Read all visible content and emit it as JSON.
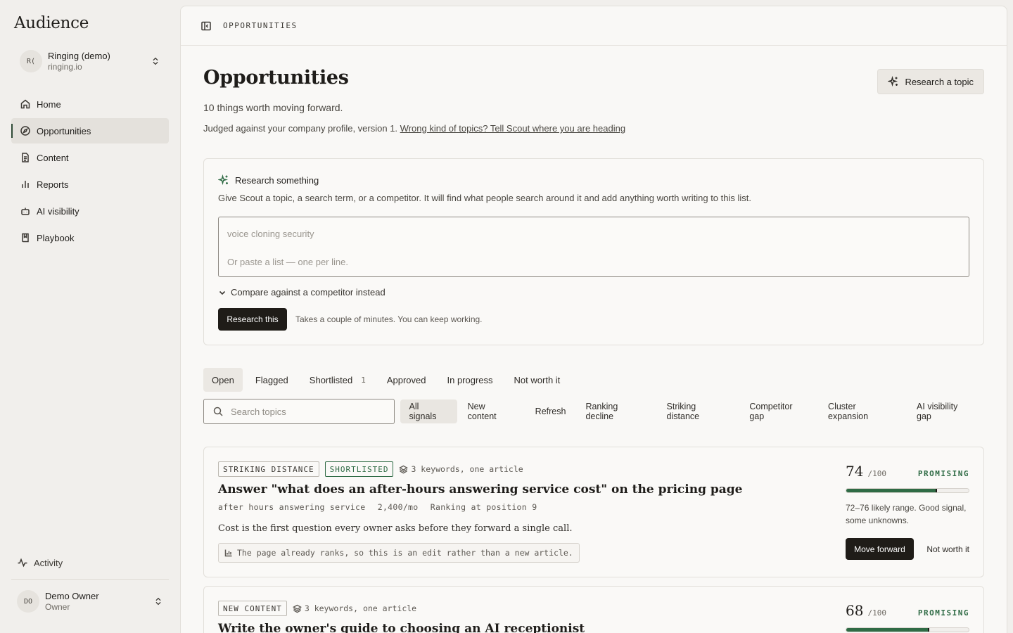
{
  "app": {
    "brand": "Audience"
  },
  "workspace": {
    "initials": "R(",
    "name": "Ringing (demo)",
    "domain": "ringing.io"
  },
  "nav": [
    {
      "label": "Home",
      "icon": "home-icon"
    },
    {
      "label": "Opportunities",
      "icon": "compass-icon",
      "active": true
    },
    {
      "label": "Content",
      "icon": "document-icon"
    },
    {
      "label": "Reports",
      "icon": "bar-chart-icon"
    },
    {
      "label": "AI visibility",
      "icon": "bot-icon"
    },
    {
      "label": "Playbook",
      "icon": "book-icon"
    }
  ],
  "activity": {
    "label": "Activity"
  },
  "user": {
    "initials": "DO",
    "name": "Demo Owner",
    "role": "Owner"
  },
  "topbar": {
    "breadcrumb": "OPPORTUNITIES"
  },
  "page": {
    "title": "Opportunities",
    "research_topic_button": "Research a topic",
    "subtitle": "10 things worth moving forward.",
    "judged_text": "Judged against your company profile, version 1.",
    "judged_link": "Wrong kind of topics? Tell Scout where you are heading"
  },
  "research": {
    "heading": "Research something",
    "description": "Give Scout a topic, a search term, or a competitor. It will find what people search around it and add anything worth writing to this list.",
    "placeholder_line1": "voice cloning security",
    "placeholder_line2": "Or paste a list — one per line.",
    "compare_label": "Compare against a competitor instead",
    "button": "Research this",
    "note": "Takes a couple of minutes. You can keep working."
  },
  "tabs": [
    {
      "label": "Open",
      "active": true
    },
    {
      "label": "Flagged"
    },
    {
      "label": "Shortlisted",
      "count": "1"
    },
    {
      "label": "Approved"
    },
    {
      "label": "In progress"
    },
    {
      "label": "Not worth it"
    }
  ],
  "search": {
    "placeholder": "Search topics"
  },
  "signal_filters": [
    {
      "label": "All signals",
      "active": true
    },
    {
      "label": "New content"
    },
    {
      "label": "Refresh"
    },
    {
      "label": "Ranking decline"
    },
    {
      "label": "Striking distance"
    },
    {
      "label": "Competitor gap"
    },
    {
      "label": "Cluster expansion"
    },
    {
      "label": "AI visibility gap"
    }
  ],
  "opportunities": [
    {
      "tag": "STRIKING DISTANCE",
      "status_tag": "SHORTLISTED",
      "keywords": "3 keywords, one article",
      "title": "Answer \"what does an after-hours answering service cost\" on the pricing page",
      "keyword": "after hours answering service",
      "volume": "2,400/mo",
      "ranking": "Ranking at position 9",
      "description": "Cost is the first question every owner asks before they forward a single call.",
      "note": "The page already ranks, so this is an edit rather than a new article.",
      "score": "74",
      "score_max": "/100",
      "score_label": "PROMISING",
      "score_fill": 0.74,
      "range_text": "72–76 likely range. Good signal, some unknowns.",
      "primary_action": "Move forward",
      "secondary_action": "Not worth it"
    },
    {
      "tag": "NEW CONTENT",
      "keywords": "3 keywords, one article",
      "title": "Write the owner's guide to choosing an AI receptionist",
      "score": "68",
      "score_max": "/100",
      "score_label": "PROMISING",
      "score_fill": 0.68
    }
  ],
  "colors": {
    "accent_green": "#2f6b45",
    "dark_button": "#1f1c18",
    "page_bg": "#f1efec"
  }
}
